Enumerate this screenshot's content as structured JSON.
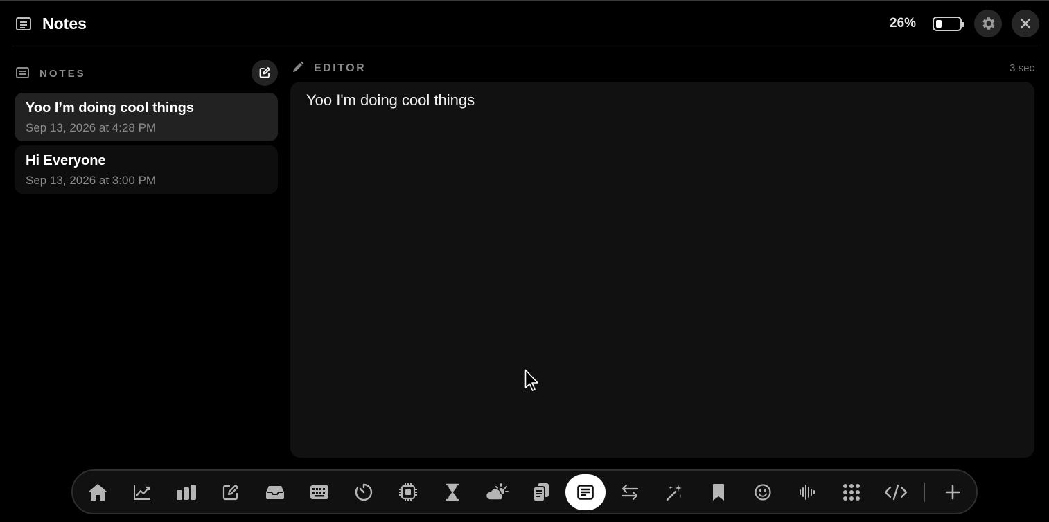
{
  "app": {
    "title": "Notes",
    "battery_percent_label": "26%",
    "battery_level": 0.26
  },
  "sidebar": {
    "title": "NOTES",
    "notes": [
      {
        "title": "Yoo I’m doing cool things",
        "date": "Sep 13, 2026 at 4:28 PM",
        "selected": true
      },
      {
        "title": "Hi Everyone",
        "date": "Sep 13, 2026 at 3:00 PM",
        "selected": false
      }
    ]
  },
  "editor": {
    "title": "EDITOR",
    "saved_ago": "3 sec",
    "content": "Yoo I'm doing cool things"
  },
  "dock": {
    "items": [
      {
        "icon": "home-icon"
      },
      {
        "icon": "line-chart-icon"
      },
      {
        "icon": "bar-chart-icon"
      },
      {
        "icon": "edit-icon"
      },
      {
        "icon": "tray-icon"
      },
      {
        "icon": "keyboard-icon"
      },
      {
        "icon": "timer-icon"
      },
      {
        "icon": "cpu-icon"
      },
      {
        "icon": "hourglass-icon"
      },
      {
        "icon": "weather-icon"
      },
      {
        "icon": "clipboard-icon"
      },
      {
        "icon": "notes-icon",
        "active": true
      },
      {
        "icon": "swap-icon"
      },
      {
        "icon": "magic-wand-icon"
      },
      {
        "icon": "bookmark-icon"
      },
      {
        "icon": "emoji-icon"
      },
      {
        "icon": "waveform-icon"
      },
      {
        "icon": "apps-grid-icon"
      },
      {
        "icon": "code-icon"
      },
      {
        "icon": "plus-icon"
      }
    ]
  },
  "colors": {
    "background": "#000000",
    "panel": "#111111",
    "selected_item": "#222222",
    "muted_text": "#8a8a8a"
  }
}
